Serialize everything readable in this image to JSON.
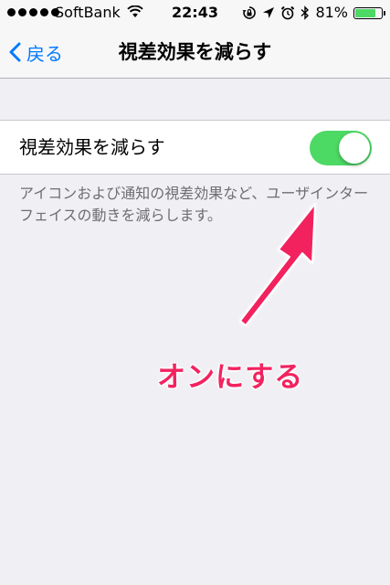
{
  "status_bar": {
    "carrier": "SoftBank",
    "time": "22:43",
    "battery_percent": "81%",
    "battery_level": 0.81,
    "icons": [
      "signal-dots-icon",
      "wifi-icon",
      "rotation-lock-icon",
      "location-icon",
      "alarm-icon",
      "bluetooth-icon",
      "battery-icon"
    ]
  },
  "nav": {
    "back_label": "戻る",
    "title": "視差効果を減らす"
  },
  "setting": {
    "label": "視差効果を減らす",
    "toggle_on": true,
    "toggle_color": "#4cd964"
  },
  "footer": {
    "description": "アイコンおよび通知の視差効果など、ユーザインターフェイスの動きを減らします。"
  },
  "annotation": {
    "text": "オンにする",
    "color": "#f2235f"
  }
}
